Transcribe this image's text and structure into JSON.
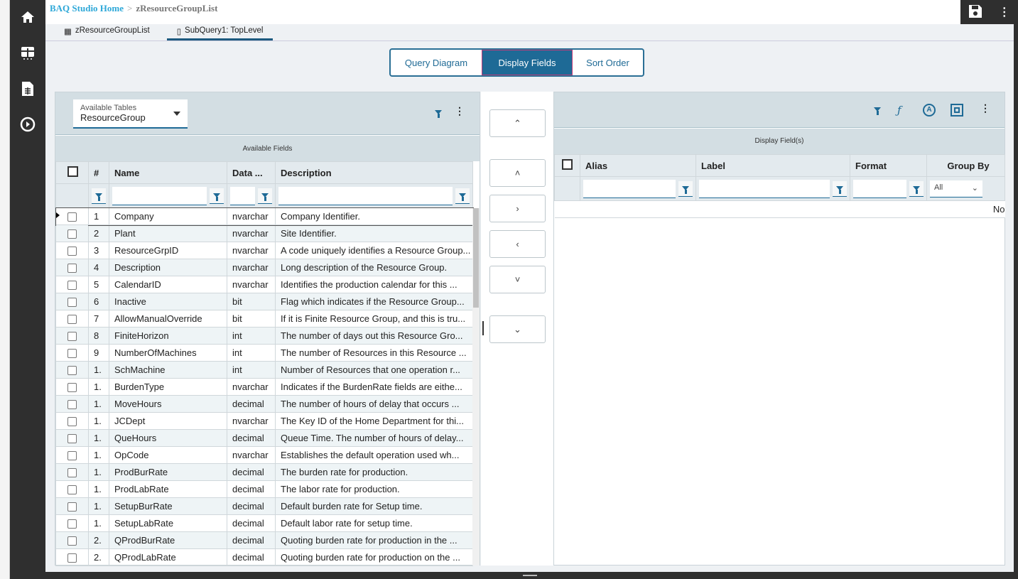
{
  "breadcrumb": {
    "home": "BAQ Studio Home",
    "separator": ">",
    "current": "zResourceGroupList"
  },
  "tabs": [
    {
      "label": "zResourceGroupList",
      "icon": "grid-icon"
    },
    {
      "label": "SubQuery1: TopLevel",
      "icon": "document-icon"
    }
  ],
  "view_tabs": [
    "Query Diagram",
    "Display Fields",
    "Sort Order"
  ],
  "active_view": "Display Fields",
  "left_panel": {
    "tables_label": "Available Tables",
    "tables_value": "ResourceGroup",
    "section_title": "Available Fields",
    "columns": [
      "#",
      "Name",
      "Data ...",
      "Description"
    ],
    "rows": [
      [
        "1",
        "Company",
        "nvarchar",
        "Company Identifier."
      ],
      [
        "2",
        "Plant",
        "nvarchar",
        "Site Identifier."
      ],
      [
        "3",
        "ResourceGrpID",
        "nvarchar",
        "A code uniquely identifies a Resource Group..."
      ],
      [
        "4",
        "Description",
        "nvarchar",
        "Long description of the Resource Group."
      ],
      [
        "5",
        "CalendarID",
        "nvarchar",
        "Identifies the production calendar for this ..."
      ],
      [
        "6",
        "Inactive",
        "bit",
        "Flag which indicates if the Resource Group..."
      ],
      [
        "7",
        "AllowManualOverride",
        "bit",
        "If it is Finite Resource Group, and this is tru..."
      ],
      [
        "8",
        "FiniteHorizon",
        "int",
        "The number of days out this Resource Gro..."
      ],
      [
        "9",
        "NumberOfMachines",
        "int",
        "The number of Resources in this Resource ..."
      ],
      [
        "1.",
        "SchMachine",
        "int",
        "Number of Resources that one operation r..."
      ],
      [
        "1.",
        "BurdenType",
        "nvarchar",
        "Indicates if the BurdenRate fields are eithe..."
      ],
      [
        "1.",
        "MoveHours",
        "decimal",
        "The number of hours of delay that occurs ..."
      ],
      [
        "1.",
        "JCDept",
        "nvarchar",
        "The Key ID of the Home Department for thi..."
      ],
      [
        "1.",
        "QueHours",
        "decimal",
        "Queue Time. The number of hours of delay..."
      ],
      [
        "1.",
        "OpCode",
        "nvarchar",
        "Establishes the default operation used wh..."
      ],
      [
        "1.",
        "ProdBurRate",
        "decimal",
        "The burden rate for production."
      ],
      [
        "1.",
        "ProdLabRate",
        "decimal",
        "The labor rate for production."
      ],
      [
        "1.",
        "SetupBurRate",
        "decimal",
        "Default burden rate for Setup time."
      ],
      [
        "1.",
        "SetupLabRate",
        "decimal",
        "Default labor rate for setup time."
      ],
      [
        "2.",
        "QProdBurRate",
        "decimal",
        "Quoting burden rate for production in the ..."
      ],
      [
        "2.",
        "QProdLabRate",
        "decimal",
        "Quoting burden rate for production on the ..."
      ]
    ]
  },
  "middle_buttons": [
    "«top",
    "‹up",
    "›add",
    "‹remove",
    "›down",
    "«bottom"
  ],
  "right_panel": {
    "section_title": "Display Field(s)",
    "columns": [
      "Alias",
      "Label",
      "Format",
      "Group By"
    ],
    "group_by_filter": "All",
    "empty_text": "No"
  }
}
